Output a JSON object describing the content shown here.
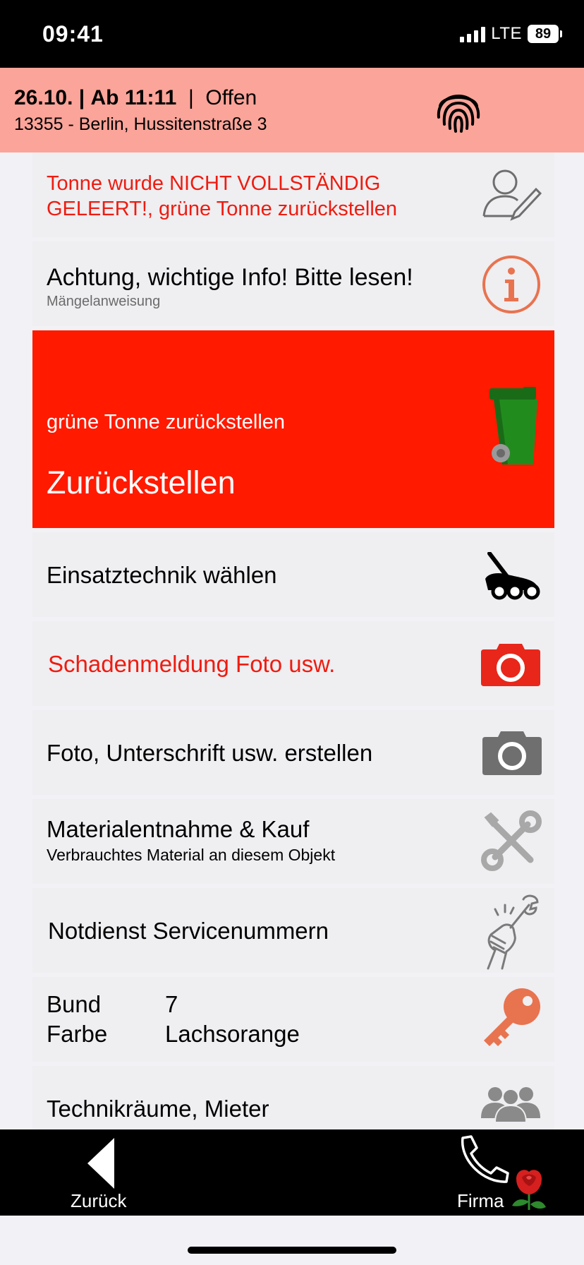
{
  "status_bar": {
    "time": "09:41",
    "network": "LTE",
    "battery": "89"
  },
  "header": {
    "date": "26.10.",
    "time_from": "Ab 11:11",
    "separator": "|",
    "status": "Offen",
    "address": "13355 - Berlin,  Hussitenstraße 3",
    "icon": "fingerprint-icon"
  },
  "colors": {
    "header_bg": "#fba499",
    "alert_red": "#ff1a00",
    "warning_text": "#ee1c10",
    "info_orange": "#e8734f",
    "key_orange": "#e8734f",
    "bin_green": "#228b1e",
    "card_bg": "#efeef1"
  },
  "items": {
    "note": {
      "text": "Tonne wurde NICHT VOLLSTÄNDIG GELEERT!, grüne Tonne zurückstellen",
      "icon": "person-edit-icon"
    },
    "info": {
      "title": "Achtung, wichtige Info! Bitte lesen!",
      "subtitle": "Mängelanweisung",
      "icon": "info-icon"
    },
    "task": {
      "subtitle": "grüne Tonne zurückstellen",
      "title": "Zurückstellen",
      "icon": "green-bin-icon"
    },
    "technique": {
      "title": "Einsatztechnik wählen",
      "icon": "lawnmower-icon"
    },
    "damage": {
      "title": "Schadenmeldung Foto usw.",
      "icon": "red-camera-icon"
    },
    "photo": {
      "title": "Foto, Unterschrift usw. erstellen",
      "icon": "camera-icon"
    },
    "material": {
      "title": "Materialentnahme & Kauf",
      "subtitle": "Verbrauchtes Material an diesem Objekt",
      "icon": "tools-icon"
    },
    "emergency": {
      "title": "Notdienst Servicenummern",
      "icon": "wrench-hand-icon"
    },
    "keys": {
      "rows": [
        {
          "label": "Bund",
          "value": "7"
        },
        {
          "label": "Farbe",
          "value": "Lachsorange"
        }
      ],
      "icon": "key-icon"
    },
    "rooms": {
      "title": "Technikräume, Mieter",
      "icon": "people-icon"
    }
  },
  "nav": {
    "back_label": "Zurück",
    "firma_label": "Firma",
    "back_icon": "back-arrow-icon",
    "phone_icon": "phone-icon",
    "rose_icon": "rose-logo-icon"
  }
}
